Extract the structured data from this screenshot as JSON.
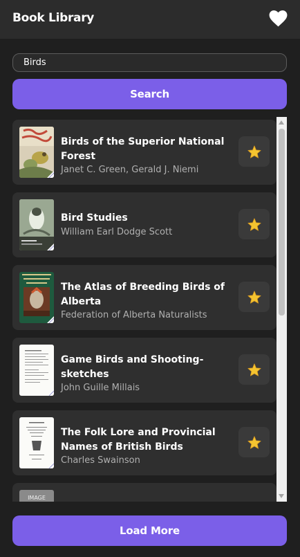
{
  "header": {
    "title": "Book Library"
  },
  "search": {
    "value": "Birds",
    "button_label": "Search"
  },
  "books": [
    {
      "title": "Birds of the Superior National Forest",
      "author": "Janet C. Green, Gerald J. Niemi"
    },
    {
      "title": "Bird Studies",
      "author": "William Earl Dodge Scott"
    },
    {
      "title": "The Atlas of Breeding Birds of Alberta",
      "author": "Federation of Alberta Naturalists"
    },
    {
      "title": "Game Birds and Shooting-sketches",
      "author": "John Guille Millais"
    },
    {
      "title": "The Folk Lore and Provincial Names of British Birds",
      "author": "Charles Swainson"
    }
  ],
  "partial_item": {
    "image_placeholder": "IMAGE"
  },
  "footer": {
    "load_more_label": "Load More"
  },
  "colors": {
    "accent": "#7b5fe8",
    "star": "#f4c430",
    "background": "#1f1f1f",
    "card": "#2f2f2f"
  }
}
